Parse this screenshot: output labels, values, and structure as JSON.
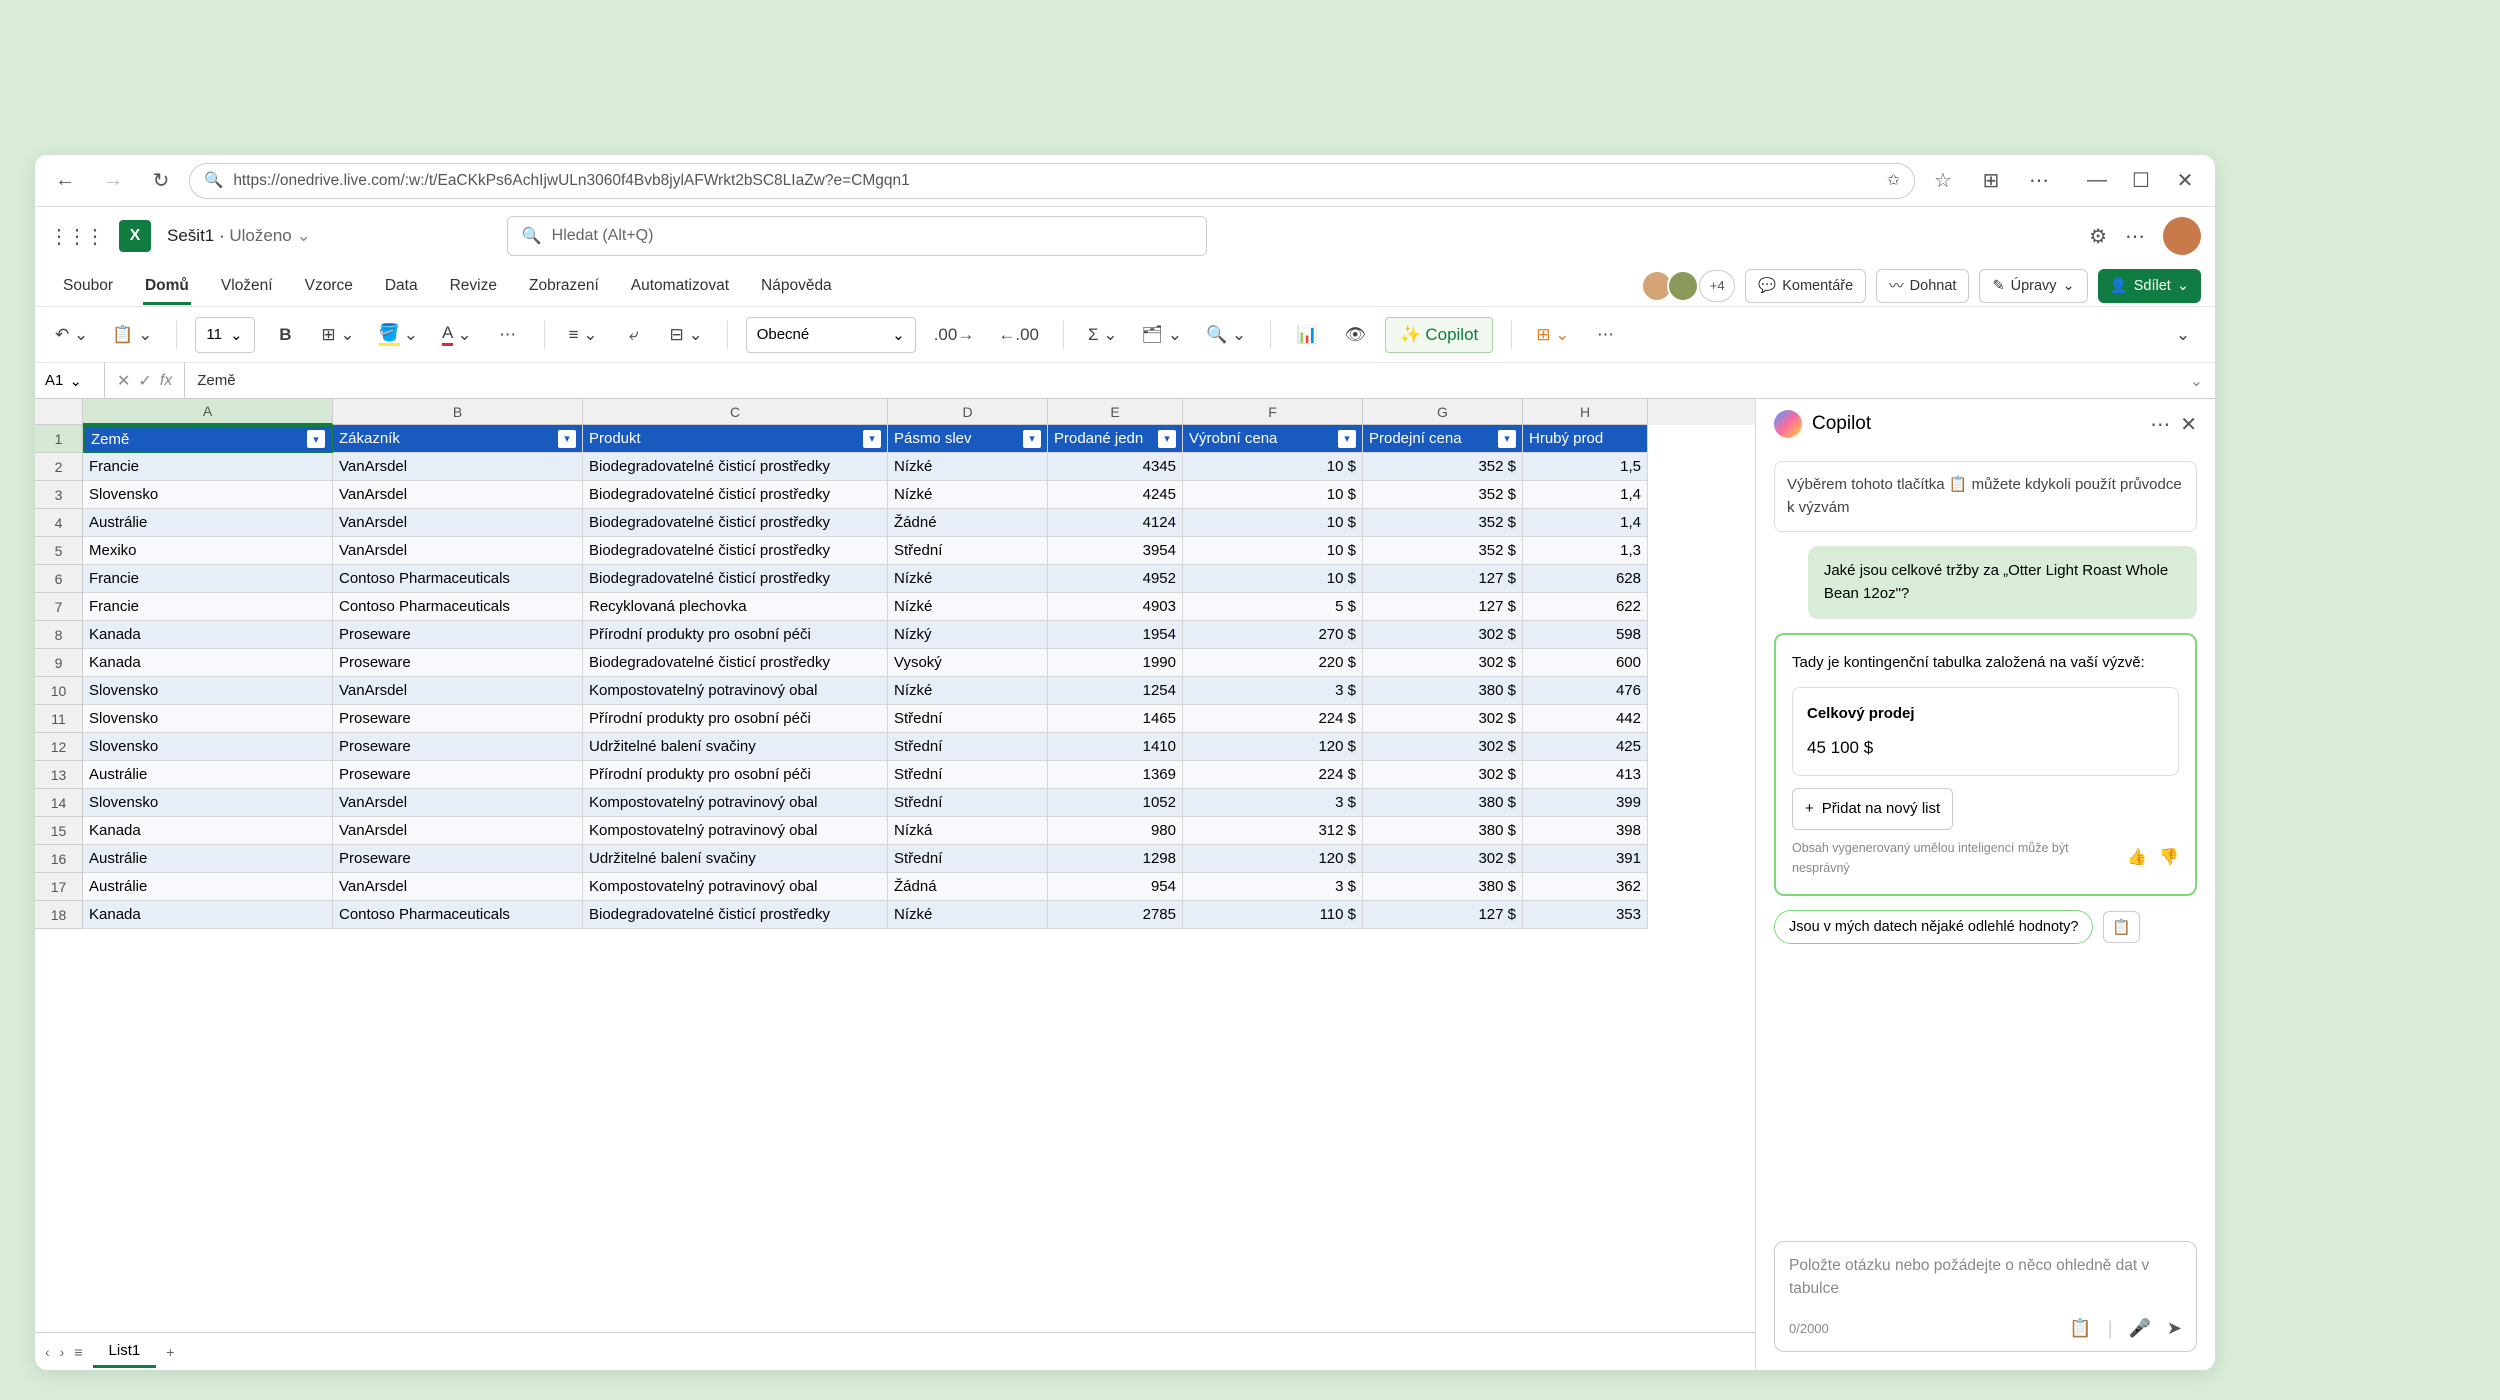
{
  "browser": {
    "url": "https://onedrive.live.com/:w:/t/EaCKkPs6AchIjwULn3060f4Bvb8jylAFWrkt2bSC8LIaZw?e=CMgqn1"
  },
  "title": {
    "doc": "Sešit1",
    "saved": "Uloženo",
    "search_placeholder": "Hledat (Alt+Q)"
  },
  "tabs": {
    "items": [
      "Soubor",
      "Domů",
      "Vložení",
      "Vzorce",
      "Data",
      "Revize",
      "Zobrazení",
      "Automatizovat",
      "Nápověda"
    ],
    "active": 1
  },
  "ribbon_right": {
    "presence_count": "+4",
    "comments": "Komentáře",
    "catchup": "Dohnat",
    "editing": "Úpravy",
    "share": "Sdílet"
  },
  "toolbar": {
    "font_size": "11",
    "num_format": "Obecné",
    "copilot": "Copilot"
  },
  "formula": {
    "ref": "A1",
    "value": "Země"
  },
  "columns": [
    "A",
    "B",
    "C",
    "D",
    "E",
    "F",
    "G",
    "H"
  ],
  "headers": [
    "Země",
    "Zákazník",
    "Produkt",
    "Pásmo slev",
    "Prodané jedn",
    "Výrobní cena",
    "Prodejní cena",
    "Hrubý prod"
  ],
  "rows": [
    [
      "Francie",
      "VanArsdel",
      "Biodegradovatelné čisticí prostředky",
      "Nízké",
      "4345",
      "10 $",
      "352 $",
      "1,5"
    ],
    [
      "Slovensko",
      "VanArsdel",
      "Biodegradovatelné čisticí prostředky",
      "Nízké",
      "4245",
      "10 $",
      "352 $",
      "1,4"
    ],
    [
      "Austrálie",
      "VanArsdel",
      "Biodegradovatelné čisticí prostředky",
      "Žádné",
      "4124",
      "10 $",
      "352 $",
      "1,4"
    ],
    [
      "Mexiko",
      "VanArsdel",
      "Biodegradovatelné čisticí prostředky",
      "Střední",
      "3954",
      "10 $",
      "352 $",
      "1,3"
    ],
    [
      "Francie",
      "Contoso Pharmaceuticals",
      "Biodegradovatelné čisticí prostředky",
      "Nízké",
      "4952",
      "10 $",
      "127 $",
      "628"
    ],
    [
      "Francie",
      "Contoso Pharmaceuticals",
      "Recyklovaná plechovka",
      "Nízké",
      "4903",
      "5 $",
      "127 $",
      "622"
    ],
    [
      "Kanada",
      "Proseware",
      "Přírodní produkty pro osobní péči",
      "Nízký",
      "1954",
      "270 $",
      "302 $",
      "598"
    ],
    [
      "Kanada",
      "Proseware",
      "Biodegradovatelné čisticí prostředky",
      "Vysoký",
      "1990",
      "220 $",
      "302 $",
      "600"
    ],
    [
      "Slovensko",
      "VanArsdel",
      "Kompostovatelný potravinový obal",
      "Nízké",
      "1254",
      "3 $",
      "380 $",
      "476"
    ],
    [
      "Slovensko",
      "Proseware",
      "Přírodní produkty pro osobní péči",
      "Střední",
      "1465",
      "224 $",
      "302 $",
      "442"
    ],
    [
      "Slovensko",
      "Proseware",
      "Udržitelné balení svačiny",
      "Střední",
      "1410",
      "120 $",
      "302 $",
      "425"
    ],
    [
      "Austrálie",
      "Proseware",
      "Přírodní produkty pro osobní péči",
      "Střední",
      "1369",
      "224 $",
      "302 $",
      "413"
    ],
    [
      "Slovensko",
      "VanArsdel",
      "Kompostovatelný potravinový obal",
      "Střední",
      "1052",
      "3 $",
      "380 $",
      "399"
    ],
    [
      "Kanada",
      "VanArsdel",
      "Kompostovatelný potravinový obal",
      "Nízká",
      "980",
      "312 $",
      "380 $",
      "398"
    ],
    [
      "Austrálie",
      "Proseware",
      "Udržitelné balení svačiny",
      "Střední",
      "1298",
      "120 $",
      "302 $",
      "391"
    ],
    [
      "Austrálie",
      "VanArsdel",
      "Kompostovatelný potravinový obal",
      "Žádná",
      "954",
      "3 $",
      "380 $",
      "362"
    ],
    [
      "Kanada",
      "Contoso Pharmaceuticals",
      "Biodegradovatelné čisticí prostředky",
      "Nízké",
      "2785",
      "110 $",
      "127 $",
      "353"
    ]
  ],
  "sheet_tab": "List1",
  "copilot": {
    "title": "Copilot",
    "tip": "Výběrem tohoto tlačítka 📋 můžete kdykoli použít průvodce k výzvám",
    "user_msg": "Jaké jsou celkové tržby za „Otter Light Roast Whole Bean 12oz\"?",
    "response_intro": "Tady je kontingenční tabulka založená na vaší výzvě:",
    "card_title": "Celkový prodej",
    "card_value": "45 100 $",
    "add_btn": "Přidat na nový list",
    "disclaimer": "Obsah vygenerovaný umělou inteligencí může být nesprávný",
    "suggestion": "Jsou v mých datech nějaké odlehlé hodnoty?",
    "input_placeholder": "Položte otázku nebo požádejte o něco ohledně dat v tabulce",
    "char_count": "0/2000"
  }
}
